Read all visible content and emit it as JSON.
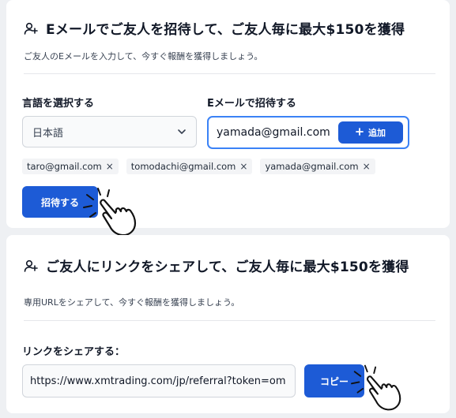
{
  "email_invite": {
    "title": "Eメールでご友人を招待して、ご友人毎に最大$150を獲得",
    "subtitle": "ご友人のEメールを入力して、今すぐ報酬を獲得しましょう。",
    "language_label": "言語を選択する",
    "language_value": "日本語",
    "email_label": "Eメールで招待する",
    "email_value": "yamada@gmail.com",
    "add_button": "追加",
    "chips": [
      "taro@gmail.com",
      "tomodachi@gmail.com",
      "yamada@gmail.com"
    ],
    "chip_remove": "×",
    "invite_button": "招待する"
  },
  "link_share": {
    "title": "ご友人にリンクをシェアして、ご友人毎に最大$150を獲得",
    "subtitle": "専用URLをシェアして、今すぐ報酬を獲得しましょう。",
    "link_label": "リンクをシェアする：",
    "url_value": "https://www.xmtrading.com/jp/referral?token=om",
    "copy_button": "コピー"
  },
  "icons": [
    "add-user-icon",
    "chevron-down-icon",
    "plus-icon",
    "close-icon",
    "hand-pointer-icon"
  ],
  "colors": {
    "primary": "#1d5bd6",
    "focus_border": "#3b82f6",
    "background": "#eef0f3"
  }
}
